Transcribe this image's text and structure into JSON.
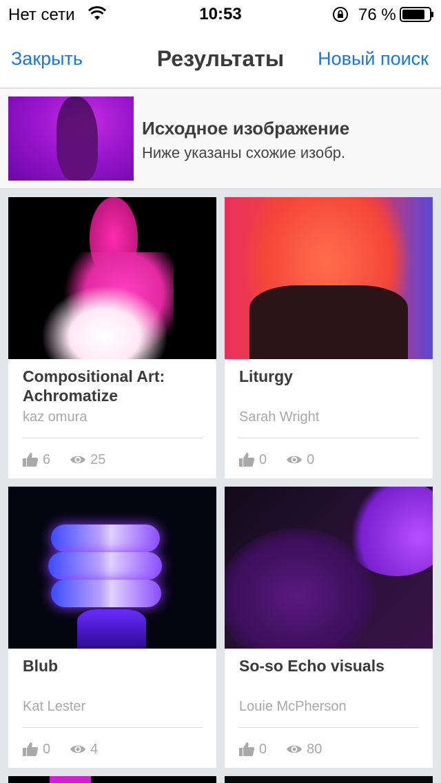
{
  "status_bar": {
    "carrier": "Нет сети",
    "time": "10:53",
    "battery_percent": "76 %"
  },
  "nav": {
    "close_label": "Закрыть",
    "title": "Результаты",
    "new_search_label": "Новый поиск"
  },
  "source": {
    "heading": "Исходное изображение",
    "subheading": "Ниже указаны схожие изобр."
  },
  "results": [
    {
      "title": "Compositional Art: Achromatize",
      "author": "kaz omura",
      "likes": "6",
      "views": "25"
    },
    {
      "title": "Liturgy",
      "author": "Sarah Wright",
      "likes": "0",
      "views": "0"
    },
    {
      "title": "Blub",
      "author": "Kat Lester",
      "likes": "0",
      "views": "4"
    },
    {
      "title": "So-so Echo visuals",
      "author": "Louie McPherson",
      "likes": "0",
      "views": "80"
    }
  ],
  "colors": {
    "accent": "#1d77d6",
    "background": "#e3e6e8",
    "muted_text": "#a8a8a8"
  }
}
